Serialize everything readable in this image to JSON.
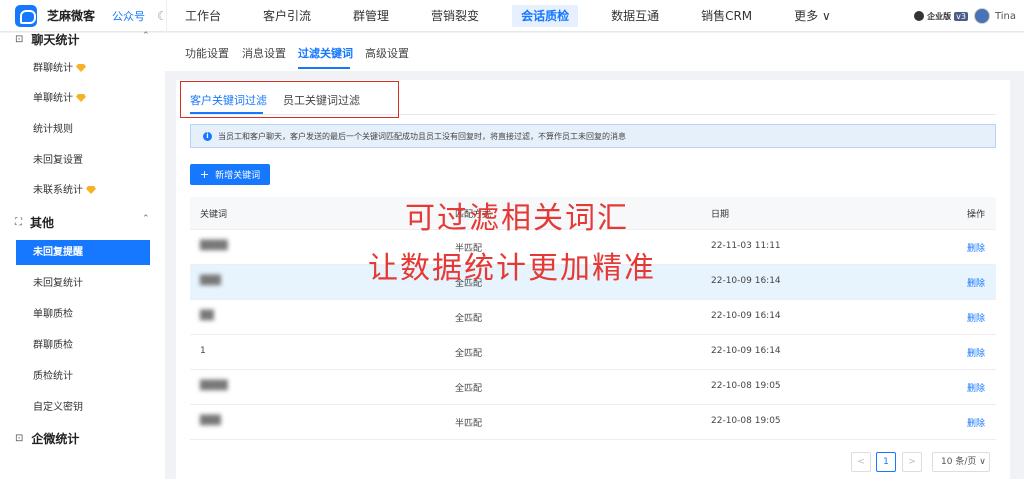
{
  "header": {
    "brand": "芝麻微客",
    "pub_label": "公众号",
    "nav": [
      "工作台",
      "客户引流",
      "群管理",
      "营销裂变",
      "会话质检",
      "数据互通",
      "销售CRM",
      "更多 ∨"
    ],
    "active_nav_index": 4,
    "enterprise_label": "企业版",
    "version_badge": "v3",
    "username": "Tina"
  },
  "sidebar": {
    "group1": {
      "label": "聊天统计",
      "icon": "chat-stats-icon"
    },
    "group1_items": [
      {
        "label": "群聊统计",
        "gem": true
      },
      {
        "label": "单聊统计",
        "gem": true
      },
      {
        "label": "统计规则",
        "gem": false
      },
      {
        "label": "未回复设置",
        "gem": false
      },
      {
        "label": "未联系统计",
        "gem": true
      }
    ],
    "group2": {
      "label": "其他",
      "icon": "other-icon"
    },
    "group2_items": [
      {
        "label": "未回复提醒",
        "active": true
      },
      {
        "label": "未回复统计"
      },
      {
        "label": "单聊质检"
      },
      {
        "label": "群聊质检"
      },
      {
        "label": "质检统计"
      },
      {
        "label": "自定义密钥"
      }
    ],
    "group3": {
      "label": "企微统计",
      "icon": "wecom-stats-icon"
    }
  },
  "subtabs": [
    "功能设置",
    "消息设置",
    "过滤关键词",
    "高级设置"
  ],
  "active_subtab_index": 2,
  "inner_tabs": [
    "客户关键词过滤",
    "员工关键词过滤"
  ],
  "alert_text": "当员工和客户聊天，客户发送的最后一个关键词匹配成功且员工没有回复时，将直接过滤，不算作员工未回复的消息",
  "add_button_label": "新增关键词",
  "table": {
    "headers": [
      "关键词",
      "匹配方式",
      "日期",
      "操作"
    ],
    "rows": [
      {
        "keyword": "████",
        "match": "半匹配",
        "date": "22-11-03 11:11",
        "action": "删除",
        "blurred": true
      },
      {
        "keyword": "███",
        "match": "全匹配",
        "date": "22-10-09 16:14",
        "action": "删除",
        "blurred": true
      },
      {
        "keyword": "██",
        "match": "全匹配",
        "date": "22-10-09 16:14",
        "action": "删除",
        "blurred": true
      },
      {
        "keyword": "1",
        "match": "全匹配",
        "date": "22-10-09 16:14",
        "action": "删除",
        "blurred": false
      },
      {
        "keyword": "████",
        "match": "全匹配",
        "date": "22-10-08 19:05",
        "action": "删除",
        "blurred": true
      },
      {
        "keyword": "███",
        "match": "半匹配",
        "date": "22-10-08 19:05",
        "action": "删除",
        "blurred": true
      }
    ]
  },
  "overlay": {
    "line1": "可过滤相关词汇",
    "line2": "让数据统计更加精准"
  },
  "pagination": {
    "prev": "<",
    "current": "1",
    "next": ">",
    "page_size": "10 条/页"
  },
  "colors": {
    "accent": "#1677ff",
    "overlay_red": "#e53935",
    "highlight_row": "#e8f4fd",
    "gem": "#f5b324"
  }
}
